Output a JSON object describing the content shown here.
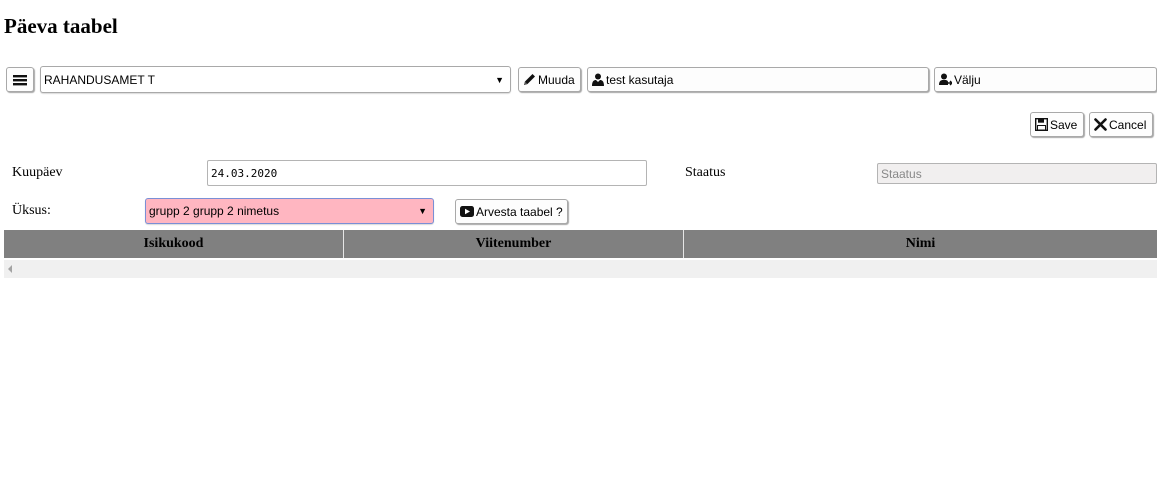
{
  "page": {
    "title": "Päeva taabel"
  },
  "toolbar": {
    "menu_icon": "hamburger-icon",
    "org_select": "RAHANDUSAMET T",
    "edit_label": "Muuda",
    "edit_icon": "pencil-icon",
    "user_icon": "user-icon",
    "user_name": "test kasutaja",
    "logout_icon": "user-logout-icon",
    "logout_label": "Välju"
  },
  "actions": {
    "save_label": "Save",
    "save_icon": "floppy-disk-icon",
    "cancel_label": "Cancel",
    "cancel_icon": "close-icon"
  },
  "form": {
    "date_label": "Kuupäev",
    "date_value": "24.03.2020",
    "status_label": "Staatus",
    "status_placeholder": "Staatus",
    "unit_label": "Üksus:",
    "unit_value": "grupp 2 grupp 2 nimetus",
    "unit_highlight_color": "#ffb6c1",
    "calc_label": "Arvesta taabel ?",
    "calc_icon": "play-video-icon"
  },
  "grid": {
    "header_color": "#808080",
    "columns": [
      "Isikukood",
      "Viitenumber",
      "Nimi"
    ],
    "rows": []
  }
}
